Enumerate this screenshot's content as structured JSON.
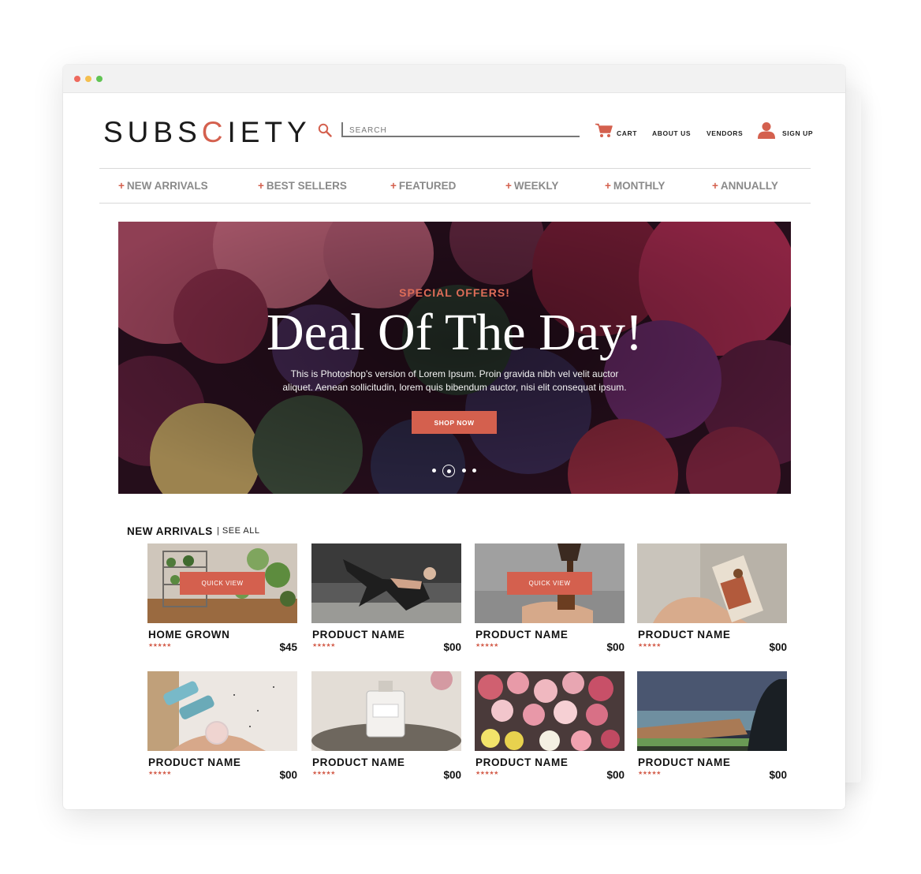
{
  "brand": {
    "logo_before": "SUBS",
    "logo_c": "C",
    "logo_after": "IETY",
    "accent_color": "#d4604e"
  },
  "search": {
    "placeholder": "SEARCH"
  },
  "header_links": {
    "cart": "CART",
    "about": "ABOUT US",
    "vendors": "VENDORS",
    "signup": "SIGN UP"
  },
  "nav": {
    "plus": "+",
    "items": [
      "NEW ARRIVALS",
      "BEST SELLERS",
      "FEATURED",
      "WEEKLY",
      "MONTHLY",
      "ANNUALLY"
    ]
  },
  "hero": {
    "eyebrow": "SPECIAL OFFERS!",
    "title": "Deal Of The Day!",
    "copy_line1": "This is Photoshop's version  of Lorem Ipsum. Proin gravida nibh vel velit auctor",
    "copy_line2": "aliquet. Aenean sollicitudin, lorem quis bibendum auctor, nisi elit consequat ipsum.",
    "button": "SHOP NOW",
    "slide_count": 4,
    "active_slide": 2
  },
  "new_arrivals": {
    "title": "NEW ARRIVALS",
    "see_all": "| SEE ALL",
    "quick_view": "QUICK VIEW",
    "stars": "★★★★★",
    "products": [
      {
        "name": "HOME GROWN",
        "price": "$45",
        "image": "plant-shelf",
        "quick_view": true
      },
      {
        "name": "PRODUCT NAME",
        "price": "$00",
        "image": "yoga-pose",
        "quick_view": false
      },
      {
        "name": "PRODUCT NAME",
        "price": "$00",
        "image": "coffee-pour",
        "quick_view": true
      },
      {
        "name": "PRODUCT NAME",
        "price": "$00",
        "image": "snack-bag",
        "quick_view": false
      },
      {
        "name": "PRODUCT NAME",
        "price": "$00",
        "image": "dumbbells",
        "quick_view": false
      },
      {
        "name": "PRODUCT NAME",
        "price": "$00",
        "image": "perfume-bottle",
        "quick_view": false
      },
      {
        "name": "PRODUCT NAME",
        "price": "$00",
        "image": "flower-bouquets",
        "quick_view": false
      },
      {
        "name": "PRODUCT NAME",
        "price": "$00",
        "image": "baseball-stadium",
        "quick_view": false
      }
    ]
  }
}
